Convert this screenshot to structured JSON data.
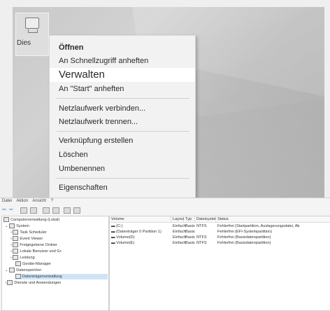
{
  "desktop": {
    "icon_label": "Dies"
  },
  "context_menu": {
    "items": [
      "Öffnen",
      "An Schnellzugriff anheften",
      "Verwalten",
      "An \"Start\" anheften",
      "Netzlaufwerk verbinden...",
      "Netzlaufwerk trennen...",
      "Verknüpfung erstellen",
      "Löschen",
      "Umbenennen",
      "Eigenschaften"
    ],
    "highlighted": "Verwalten"
  },
  "mmc": {
    "menu": [
      "Datei",
      "Aktion",
      "Ansicht",
      "?"
    ],
    "tree": [
      "Computerverwaltung (Lokal)",
      "System",
      "Task Scheduler",
      "Event Viewer",
      "Freigegebene Ordner",
      "Lokale Benutzer und Gr.",
      "Leistung",
      "Geräte-Manager",
      "Datenspeicher",
      "Datenträgerverwaltung",
      "Dienste und Anwendungen"
    ],
    "columns": [
      "Volume",
      "Layout",
      "Typ",
      "Dateisystem",
      "Status"
    ],
    "rows": [
      {
        "volume": "(C:)",
        "layout": "Einfach",
        "typ": "Basis",
        "fs": "NTFS",
        "status": "Fehlerfrei (Startpartition, Auslagerungsdatei, Ab"
      },
      {
        "volume": "(Datenträger 0 Partition 1)",
        "layout": "Einfach",
        "typ": "Basis",
        "fs": "",
        "status": "Fehlerfrei (EFI-Systempartition)"
      },
      {
        "volume": "Volume(D)",
        "layout": "Einfach",
        "typ": "Basis",
        "fs": "NTFS",
        "status": "Fehlerfrei (Basisdatenpartition)"
      },
      {
        "volume": "Volume(E)",
        "layout": "Einfach",
        "typ": "Basis",
        "fs": "NTFS",
        "status": "Fehlerfrei (Basisdatenpartition)"
      }
    ]
  }
}
